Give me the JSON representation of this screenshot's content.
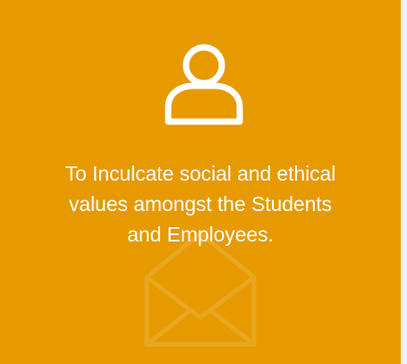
{
  "card": {
    "background_color": "#e69a00",
    "text_color": "#ffffff",
    "icon": "user-icon",
    "watermark_icon": "envelope-icon",
    "text_lines": [
      "To Inculcate social and ethical",
      "values amongst the Students",
      "and Employees."
    ]
  }
}
